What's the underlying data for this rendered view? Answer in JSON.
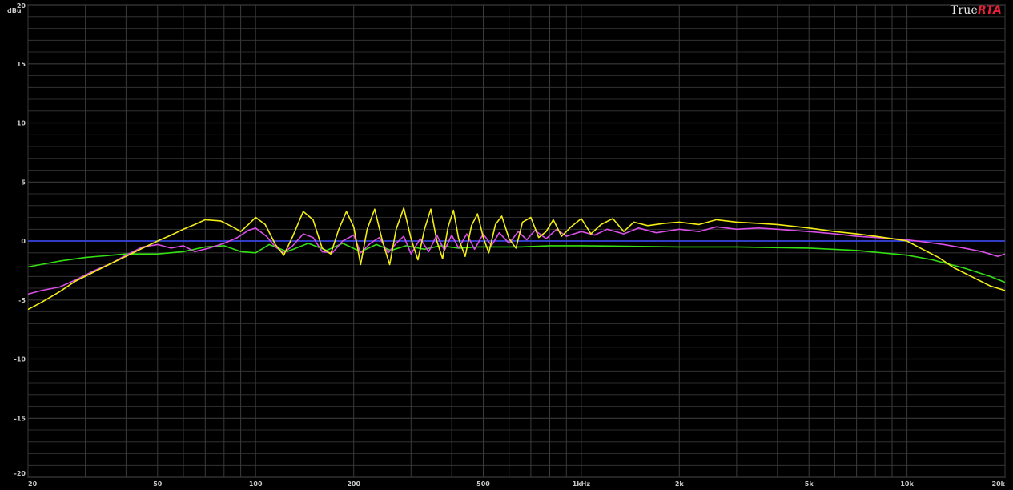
{
  "brand": {
    "prefix": "True",
    "accent": "RTA"
  },
  "chart_data": {
    "type": "line",
    "ylabel": "dBu",
    "xscale": "log",
    "xlim": [
      20,
      20000
    ],
    "ylim": [
      -20,
      20
    ],
    "grid": true,
    "xticks": [
      {
        "value": 20,
        "label": "20"
      },
      {
        "value": 50,
        "label": "50"
      },
      {
        "value": 100,
        "label": "100"
      },
      {
        "value": 200,
        "label": "200"
      },
      {
        "value": 500,
        "label": "500"
      },
      {
        "value": 1000,
        "label": "1kHz"
      },
      {
        "value": 2000,
        "label": "2k"
      },
      {
        "value": 5000,
        "label": "5k"
      },
      {
        "value": 10000,
        "label": "10k"
      },
      {
        "value": 20000,
        "label": "20k"
      }
    ],
    "yticks": [
      {
        "value": 20,
        "label": "20"
      },
      {
        "value": 15,
        "label": "15"
      },
      {
        "value": 10,
        "label": "10"
      },
      {
        "value": 5,
        "label": "5"
      },
      {
        "value": 0,
        "label": "0"
      },
      {
        "value": -5,
        "label": "-5"
      },
      {
        "value": -10,
        "label": "-10"
      },
      {
        "value": -15,
        "label": "-15"
      },
      {
        "value": -20,
        "label": "-20"
      }
    ],
    "colors": {
      "background": "#000000",
      "grid": "#3a3a3a",
      "frame": "#9a9a9a"
    },
    "series": [
      {
        "color": "#3b4cff",
        "points": [
          [
            20,
            0.0
          ],
          [
            20000,
            0.0
          ]
        ]
      },
      {
        "color": "#33e011",
        "points": [
          [
            20,
            -2.2
          ],
          [
            25,
            -1.7
          ],
          [
            30,
            -1.4
          ],
          [
            40,
            -1.1
          ],
          [
            50,
            -1.1
          ],
          [
            60,
            -0.9
          ],
          [
            70,
            -0.5
          ],
          [
            80,
            -0.4
          ],
          [
            90,
            -0.9
          ],
          [
            100,
            -1.0
          ],
          [
            110,
            -0.3
          ],
          [
            125,
            -0.9
          ],
          [
            145,
            -0.2
          ],
          [
            165,
            -0.8
          ],
          [
            185,
            -0.2
          ],
          [
            210,
            -0.9
          ],
          [
            235,
            -0.3
          ],
          [
            260,
            -0.8
          ],
          [
            290,
            -0.4
          ],
          [
            330,
            -0.7
          ],
          [
            370,
            -0.4
          ],
          [
            420,
            -0.6
          ],
          [
            480,
            -0.5
          ],
          [
            560,
            -0.5
          ],
          [
            650,
            -0.5
          ],
          [
            800,
            -0.4
          ],
          [
            1000,
            -0.4
          ],
          [
            2000,
            -0.5
          ],
          [
            3000,
            -0.5
          ],
          [
            5000,
            -0.6
          ],
          [
            7000,
            -0.8
          ],
          [
            10000,
            -1.2
          ],
          [
            12000,
            -1.6
          ],
          [
            15000,
            -2.3
          ],
          [
            18000,
            -3.0
          ],
          [
            20000,
            -3.5
          ]
        ]
      },
      {
        "color": "#d94fe8",
        "points": [
          [
            20,
            -4.5
          ],
          [
            22,
            -4.2
          ],
          [
            25,
            -3.9
          ],
          [
            28,
            -3.3
          ],
          [
            32,
            -2.5
          ],
          [
            36,
            -1.9
          ],
          [
            40,
            -1.2
          ],
          [
            45,
            -0.5
          ],
          [
            50,
            -0.3
          ],
          [
            55,
            -0.6
          ],
          [
            60,
            -0.4
          ],
          [
            65,
            -0.9
          ],
          [
            72,
            -0.6
          ],
          [
            80,
            -0.2
          ],
          [
            88,
            0.3
          ],
          [
            95,
            0.9
          ],
          [
            100,
            1.1
          ],
          [
            108,
            0.4
          ],
          [
            115,
            -0.5
          ],
          [
            122,
            -1.0
          ],
          [
            130,
            -0.4
          ],
          [
            140,
            0.6
          ],
          [
            150,
            0.3
          ],
          [
            160,
            -0.9
          ],
          [
            172,
            -1.0
          ],
          [
            185,
            0.0
          ],
          [
            200,
            0.5
          ],
          [
            210,
            -1.0
          ],
          [
            225,
            -0.2
          ],
          [
            240,
            0.3
          ],
          [
            255,
            -1.0
          ],
          [
            270,
            -0.2
          ],
          [
            285,
            0.4
          ],
          [
            300,
            -1.1
          ],
          [
            320,
            0.2
          ],
          [
            340,
            -0.9
          ],
          [
            360,
            0.5
          ],
          [
            380,
            -0.8
          ],
          [
            400,
            0.5
          ],
          [
            420,
            -0.6
          ],
          [
            445,
            0.6
          ],
          [
            470,
            -0.7
          ],
          [
            500,
            0.6
          ],
          [
            530,
            -0.4
          ],
          [
            560,
            0.7
          ],
          [
            600,
            -0.2
          ],
          [
            640,
            0.8
          ],
          [
            680,
            0.1
          ],
          [
            720,
            0.9
          ],
          [
            780,
            0.2
          ],
          [
            840,
            1.0
          ],
          [
            900,
            0.4
          ],
          [
            1000,
            0.8
          ],
          [
            1100,
            0.5
          ],
          [
            1200,
            1.0
          ],
          [
            1350,
            0.6
          ],
          [
            1500,
            1.1
          ],
          [
            1700,
            0.7
          ],
          [
            2000,
            1.0
          ],
          [
            2300,
            0.8
          ],
          [
            2600,
            1.2
          ],
          [
            3000,
            1.0
          ],
          [
            3500,
            1.1
          ],
          [
            4000,
            1.0
          ],
          [
            5000,
            0.8
          ],
          [
            6000,
            0.6
          ],
          [
            7000,
            0.4
          ],
          [
            8000,
            0.3
          ],
          [
            9000,
            0.2
          ],
          [
            10000,
            0.1
          ],
          [
            11500,
            -0.1
          ],
          [
            13000,
            -0.3
          ],
          [
            15000,
            -0.6
          ],
          [
            17000,
            -0.9
          ],
          [
            19000,
            -1.3
          ],
          [
            20000,
            -1.1
          ]
        ]
      },
      {
        "color": "#f2ec14",
        "points": [
          [
            20,
            -5.8
          ],
          [
            22,
            -5.2
          ],
          [
            25,
            -4.3
          ],
          [
            28,
            -3.4
          ],
          [
            32,
            -2.6
          ],
          [
            36,
            -1.9
          ],
          [
            40,
            -1.3
          ],
          [
            45,
            -0.6
          ],
          [
            50,
            0.0
          ],
          [
            55,
            0.5
          ],
          [
            60,
            1.0
          ],
          [
            65,
            1.4
          ],
          [
            70,
            1.8
          ],
          [
            78,
            1.7
          ],
          [
            85,
            1.2
          ],
          [
            90,
            0.8
          ],
          [
            95,
            1.4
          ],
          [
            100,
            2.0
          ],
          [
            107,
            1.4
          ],
          [
            115,
            -0.3
          ],
          [
            122,
            -1.2
          ],
          [
            130,
            0.4
          ],
          [
            140,
            2.5
          ],
          [
            150,
            1.8
          ],
          [
            160,
            -0.6
          ],
          [
            170,
            -1.1
          ],
          [
            180,
            1.0
          ],
          [
            190,
            2.5
          ],
          [
            200,
            1.2
          ],
          [
            210,
            -2.0
          ],
          [
            220,
            1.0
          ],
          [
            232,
            2.7
          ],
          [
            245,
            0.0
          ],
          [
            258,
            -2.0
          ],
          [
            270,
            1.0
          ],
          [
            285,
            2.8
          ],
          [
            300,
            0.2
          ],
          [
            315,
            -1.6
          ],
          [
            330,
            1.0
          ],
          [
            345,
            2.7
          ],
          [
            360,
            0.0
          ],
          [
            375,
            -1.5
          ],
          [
            390,
            1.2
          ],
          [
            405,
            2.6
          ],
          [
            420,
            0.2
          ],
          [
            440,
            -1.3
          ],
          [
            460,
            1.3
          ],
          [
            480,
            2.3
          ],
          [
            500,
            0.3
          ],
          [
            520,
            -1.0
          ],
          [
            545,
            1.4
          ],
          [
            570,
            2.1
          ],
          [
            600,
            0.2
          ],
          [
            630,
            -0.6
          ],
          [
            660,
            1.6
          ],
          [
            700,
            2.0
          ],
          [
            740,
            0.3
          ],
          [
            780,
            0.8
          ],
          [
            820,
            1.8
          ],
          [
            870,
            0.4
          ],
          [
            930,
            1.2
          ],
          [
            1000,
            1.9
          ],
          [
            1070,
            0.6
          ],
          [
            1150,
            1.4
          ],
          [
            1250,
            1.9
          ],
          [
            1350,
            0.8
          ],
          [
            1450,
            1.6
          ],
          [
            1600,
            1.3
          ],
          [
            1800,
            1.5
          ],
          [
            2000,
            1.6
          ],
          [
            2300,
            1.4
          ],
          [
            2600,
            1.8
          ],
          [
            3000,
            1.6
          ],
          [
            3500,
            1.5
          ],
          [
            4000,
            1.4
          ],
          [
            5000,
            1.1
          ],
          [
            6000,
            0.8
          ],
          [
            7000,
            0.6
          ],
          [
            8000,
            0.4
          ],
          [
            9000,
            0.2
          ],
          [
            10000,
            0.0
          ],
          [
            11000,
            -0.6
          ],
          [
            12500,
            -1.4
          ],
          [
            14000,
            -2.3
          ],
          [
            16000,
            -3.1
          ],
          [
            18000,
            -3.8
          ],
          [
            20000,
            -4.2
          ]
        ]
      }
    ]
  }
}
